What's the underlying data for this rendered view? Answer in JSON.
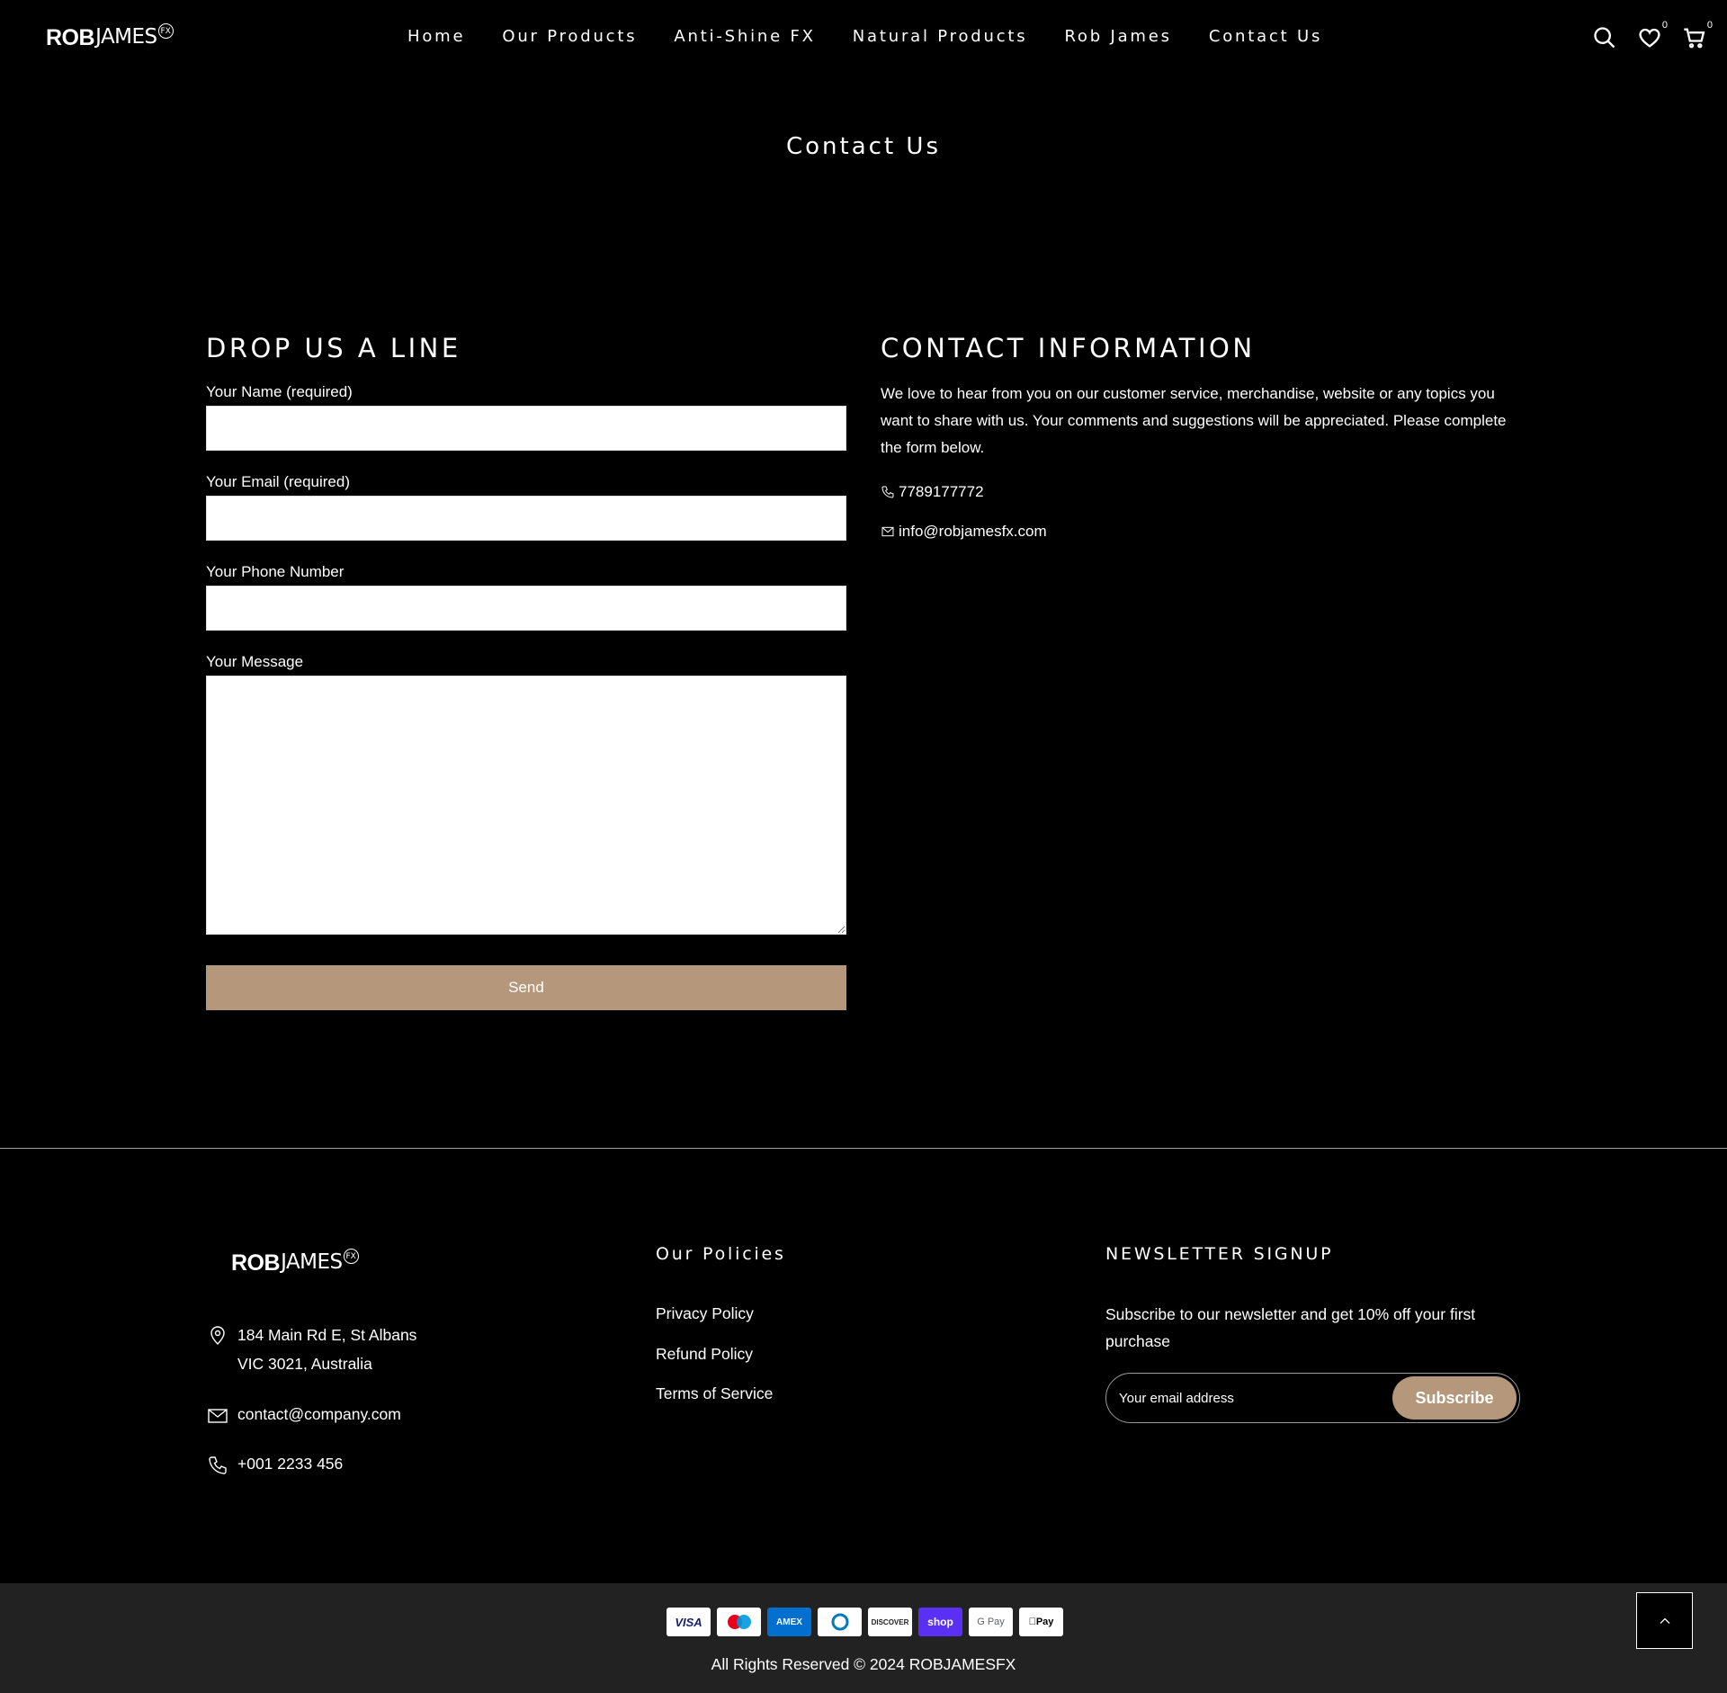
{
  "header": {
    "logo_bold": "ROB",
    "logo_thin": "JAMES",
    "logo_badge": "FX",
    "nav": [
      "Home",
      "Our Products",
      "Anti-Shine FX",
      "Natural Products",
      "Rob James",
      "Contact Us"
    ],
    "wishlist_count": "0",
    "cart_count": "0"
  },
  "page": {
    "title": "Contact Us"
  },
  "form": {
    "heading": "DROP US A LINE",
    "name_label": "Your Name (required)",
    "email_label": "Your Email (required)",
    "phone_label": "Your Phone Number",
    "message_label": "Your Message",
    "send_label": "Send"
  },
  "info": {
    "heading": "CONTACT INFORMATION",
    "text": "We love to hear from you on our customer service, merchandise, website or any topics you want to share with us. Your comments and suggestions will be appreciated. Please complete the form below.",
    "phone": "7789177772",
    "email": "info@robjamesfx.com"
  },
  "footer": {
    "address_line1": "184 Main Rd E, St Albans",
    "address_line2": "VIC 3021, Australia",
    "email": "contact@company.com",
    "phone": "+001 2233 456",
    "policies_title": "Our Policies",
    "policies": [
      "Privacy Policy",
      "Refund Policy",
      "Terms of Service"
    ],
    "newsletter_title": "NEWSLETTER SIGNUP",
    "newsletter_text": "Subscribe to our newsletter and get 10% off your first purchase",
    "newsletter_placeholder": "Your email address",
    "subscribe_label": "Subscribe",
    "payments": [
      "VISA",
      "maestro",
      "AMEX",
      "diners",
      "DISCOVER",
      "shop",
      "G Pay",
      "Apple Pay"
    ],
    "copyright": "All Rights Reserved © 2024 ROBJAMESFX"
  },
  "colors": {
    "background": "#000000",
    "accent": "#b5987b",
    "bottom_bar": "#222222"
  }
}
